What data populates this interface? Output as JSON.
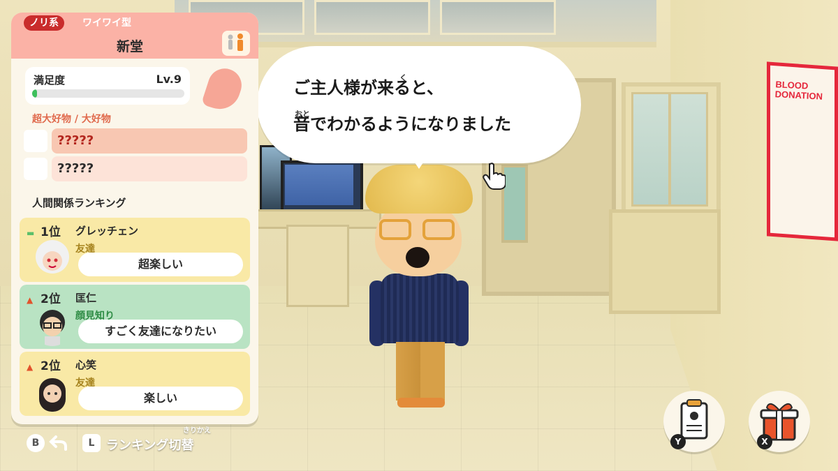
{
  "info_panel": {
    "personality_tag": "ノリ系",
    "personality_type": "ワイワイ型",
    "name": "新堂",
    "satisfaction": {
      "label": "満足度",
      "level": "Lv.9",
      "progress": 0.03
    },
    "favorites_header": "超大好物 / 大好物",
    "favorites": [
      "?????",
      "?????"
    ],
    "ranking_title": "人間関係ランキング",
    "ranking": [
      {
        "rank": "1位",
        "trend": "same",
        "name": "グレッチェン",
        "relation": "友達",
        "status": "超楽しい",
        "color": "#f9e9a6"
      },
      {
        "rank": "2位",
        "trend": "up",
        "name": "匡仁",
        "relation": "顔見知り",
        "status": "すごく友達になりたい",
        "color": "#b9e3c3"
      },
      {
        "rank": "2位",
        "trend": "up",
        "name": "心笑",
        "relation": "友達",
        "status": "楽しい",
        "color": "#f9e9a6"
      }
    ]
  },
  "speech_bubble": {
    "line1": "ご主人様が来ると、",
    "line1_ruby": "く",
    "line2": "音でわかるようになりました",
    "line2_ruby": "おと"
  },
  "controls": {
    "back_button": "B",
    "back_icon": "back-arrow-icon",
    "switch_button": "L",
    "switch_label": "ランキング切替",
    "switch_ruby": "きりかえ",
    "action_y_badge": "Y",
    "action_x_badge": "X"
  },
  "scene": {
    "poster_title": "BLOOD\nDONATION"
  },
  "colors": {
    "accent_red": "#c92c2c",
    "panel_header": "#fbb2a6",
    "fav_top": "#f8c7b2",
    "fav_second": "#fde3d8",
    "progress_green": "#3ec05d"
  }
}
